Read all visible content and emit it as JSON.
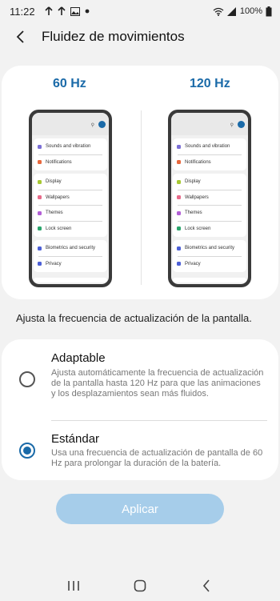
{
  "status_bar": {
    "time": "11:22",
    "battery": "100%"
  },
  "header": {
    "title": "Fluidez de movimientos"
  },
  "preview": {
    "left_label": "60 Hz",
    "right_label": "120 Hz",
    "phone_menu": [
      [
        "Sounds and vibration",
        "Notifications"
      ],
      [
        "Display",
        "Wallpapers",
        "Themes",
        "Lock screen"
      ],
      [
        "Biometrics and security",
        "Privacy"
      ]
    ],
    "menu_colors": [
      "#7b6fd6",
      "#e8683d",
      "#a7c832",
      "#e86a8a",
      "#b25fd6",
      "#2aa56c",
      "#4c5fd6",
      "#4c5fd6"
    ]
  },
  "description": "Ajusta la frecuencia de actualización de la pantalla.",
  "options": [
    {
      "title": "Adaptable",
      "subtitle": "Ajusta automáticamente la frecuencia de actualización de la pantalla hasta 120 Hz para que las animaciones y los desplazamientos sean más fluidos.",
      "selected": false
    },
    {
      "title": "Estándar",
      "subtitle": "Usa una frecuencia de actualización de pantalla de 60 Hz para prolongar la duración de la batería.",
      "selected": true
    }
  ],
  "apply_button": {
    "label": "Aplicar",
    "enabled": false
  },
  "nav": {
    "icons": [
      "recents-icon",
      "home-icon",
      "back-icon"
    ]
  },
  "colors": {
    "accent": "#1a6aa8",
    "button_disabled": "#a6cdea",
    "background": "#f2f2f2"
  }
}
